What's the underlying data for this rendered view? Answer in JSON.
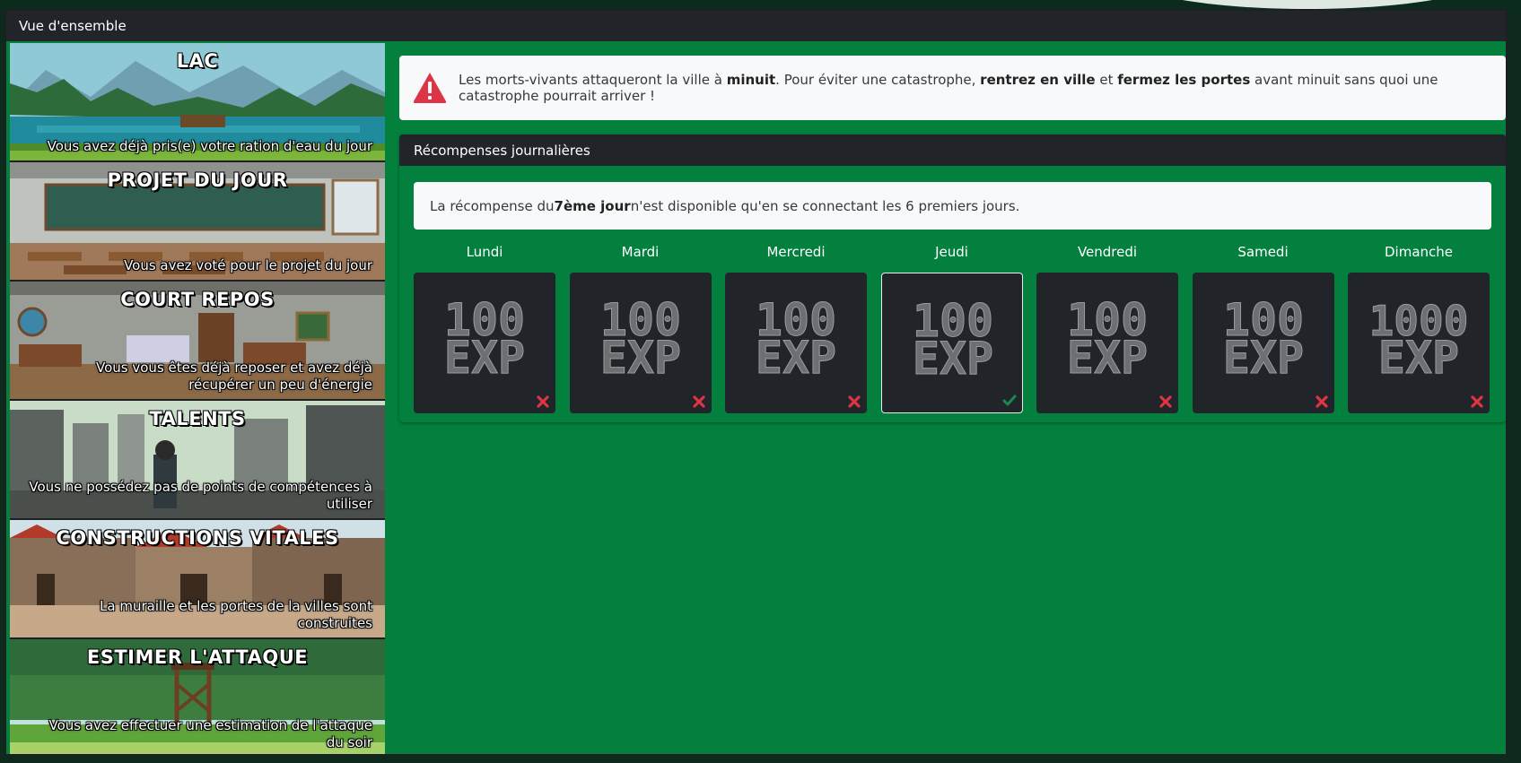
{
  "window": {
    "title": "Vue d'ensemble"
  },
  "sidebar": {
    "cards": [
      {
        "title": "LAC",
        "text": "Vous avez déjà pris(e) votre ration d'eau du jour"
      },
      {
        "title": "PROJET DU JOUR",
        "text": "Vous avez voté pour le projet du jour"
      },
      {
        "title": "COURT REPOS",
        "text": "Vous vous êtes déjà reposer et avez déjà récupérer un peu d'énergie"
      },
      {
        "title": "TALENTS",
        "text": "Vous ne possédez pas de points de compétences à utiliser"
      },
      {
        "title": "CONSTRUCTIONS VITALES",
        "text": "La muraille et les portes de la villes sont construites"
      },
      {
        "title": "ESTIMER L'ATTAQUE",
        "text": "Vous avez effectuer une estimation de l'attaque du soir"
      }
    ]
  },
  "alert": {
    "icon": "warning-triangle-icon",
    "color": "#dc3545",
    "part1": "Les morts-vivants attaqueront la ville à ",
    "bold1": "minuit",
    "part2": ". Pour éviter une catastrophe, ",
    "bold2": "rentrez en ville",
    "part3": " et ",
    "bold3": "fermez les portes",
    "part4": " avant minuit sans quoi une catastrophe pourrait arriver !"
  },
  "rewards": {
    "title": "Récompenses journalières",
    "info_part1": "La récompense du ",
    "info_bold": "7ème jour",
    "info_part2": " n'est disponible qu'en se connectant les 6 premiers jours.",
    "days": [
      {
        "name": "Lundi",
        "amount": "100",
        "unit": "EXP",
        "status": "missed"
      },
      {
        "name": "Mardi",
        "amount": "100",
        "unit": "EXP",
        "status": "missed"
      },
      {
        "name": "Mercredi",
        "amount": "100",
        "unit": "EXP",
        "status": "missed"
      },
      {
        "name": "Jeudi",
        "amount": "100",
        "unit": "EXP",
        "status": "claimed"
      },
      {
        "name": "Vendredi",
        "amount": "100",
        "unit": "EXP",
        "status": "missed"
      },
      {
        "name": "Samedi",
        "amount": "100",
        "unit": "EXP",
        "status": "missed"
      },
      {
        "name": "Dimanche",
        "amount": "1000",
        "unit": "EXP",
        "status": "missed"
      }
    ],
    "colors": {
      "missed": "#dc3545",
      "claimed": "#198754"
    }
  }
}
